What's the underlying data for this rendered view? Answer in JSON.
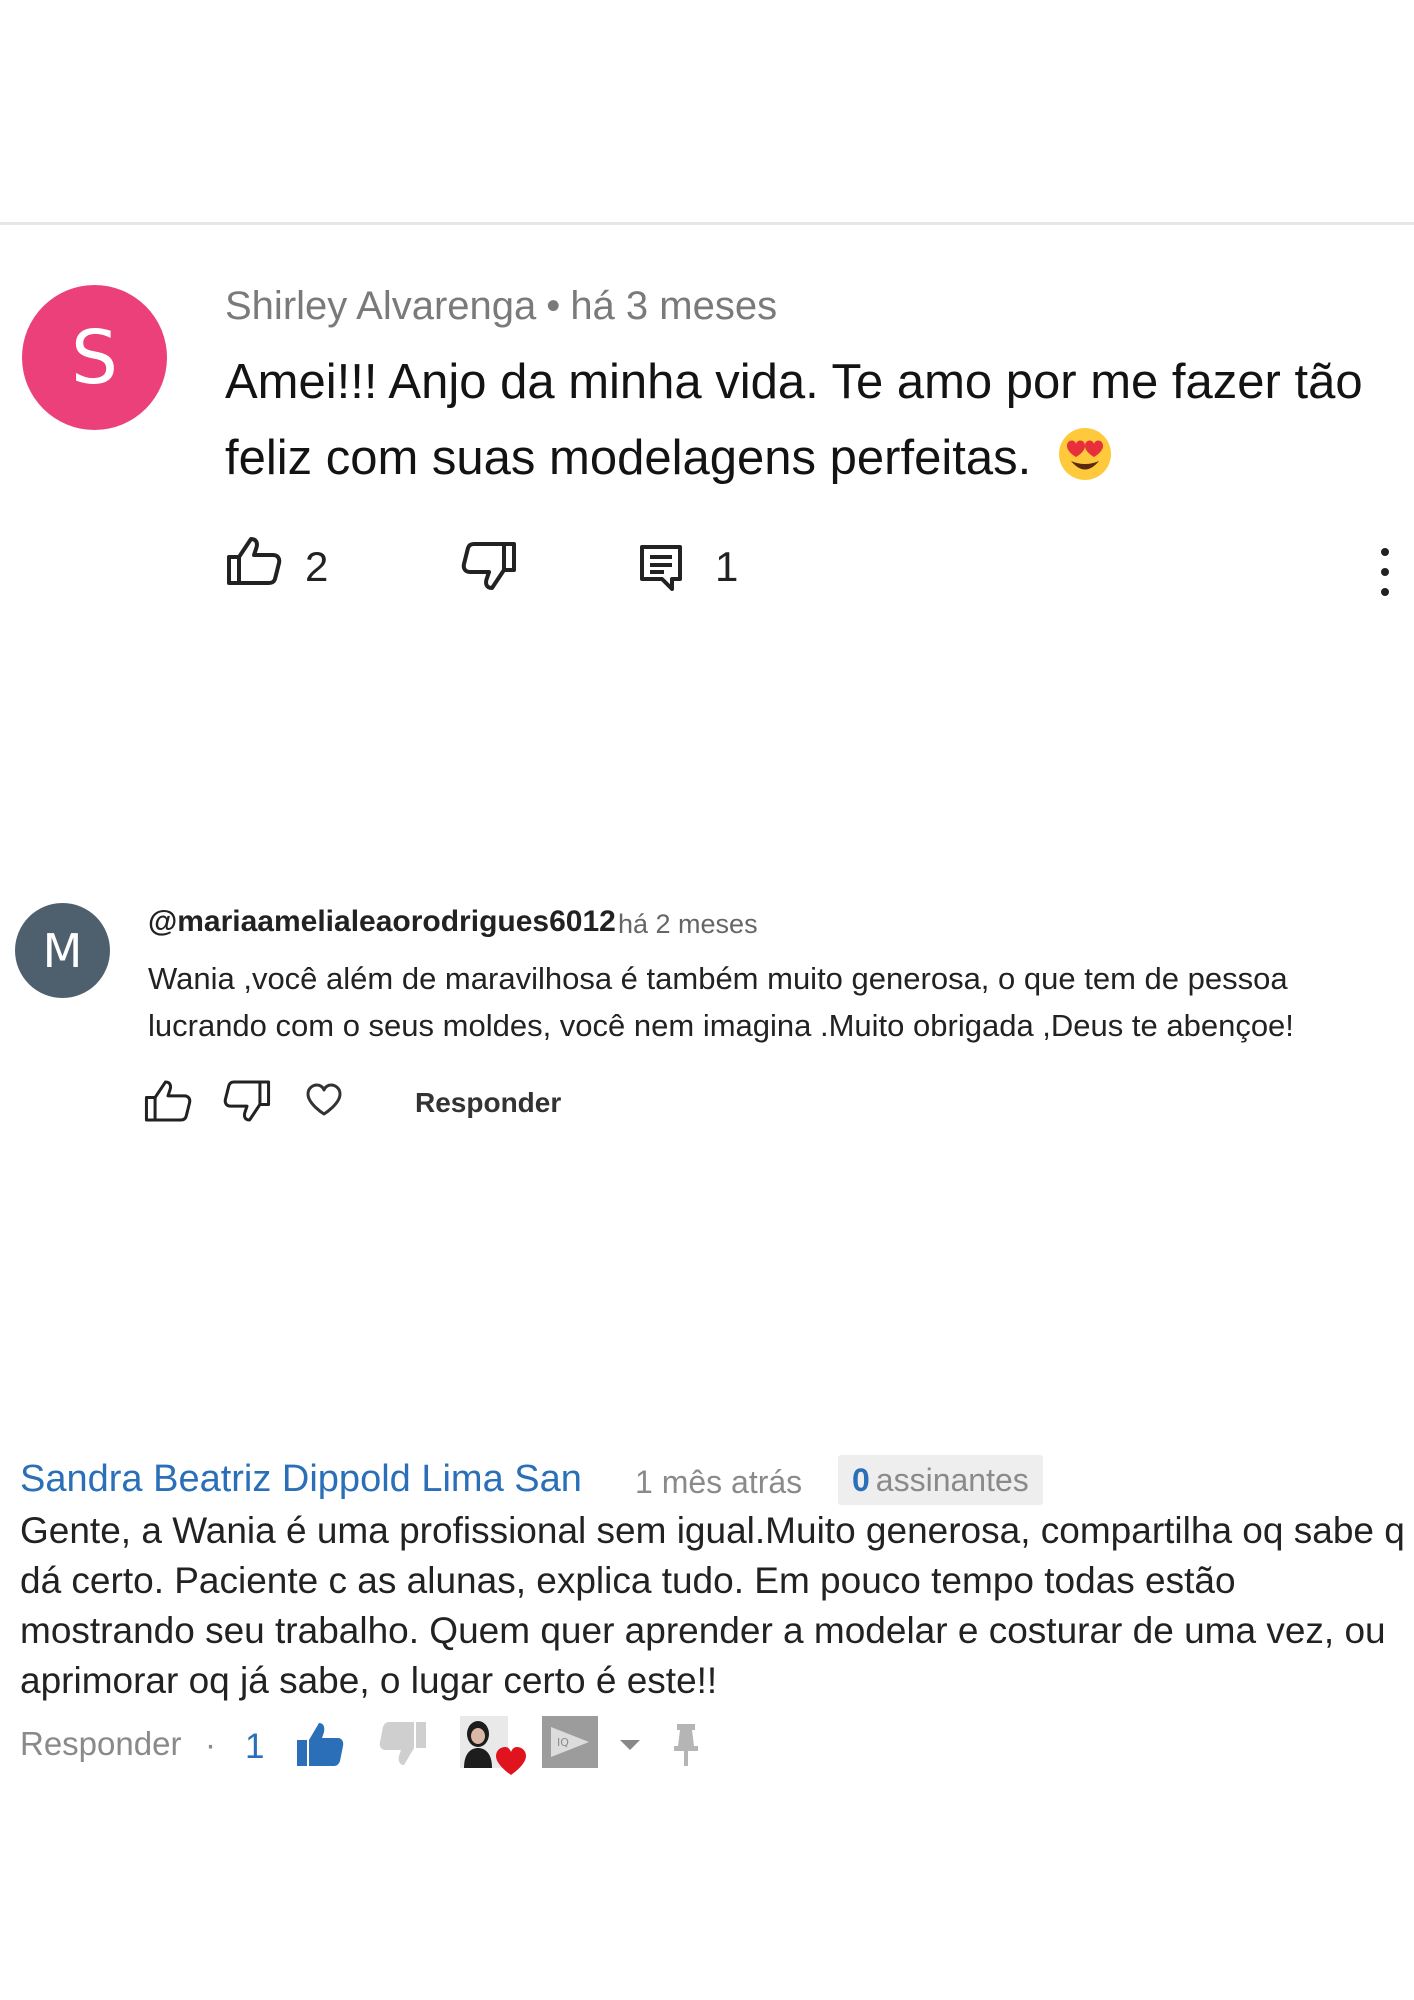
{
  "comments": {
    "first": {
      "avatar_letter": "S",
      "avatar_color": "#ec407a",
      "author": "Shirley Alvarenga",
      "separator": "•",
      "time": "há 3 meses",
      "text": "Amei!!! Anjo da minha vida. Te amo por me fazer tão feliz com suas modelagens perfeitas.",
      "emoji_icon": "heart-eyes-emoji-icon",
      "like_count": "2",
      "reply_count": "1",
      "icons": [
        "thumbs-up-icon",
        "thumbs-down-icon",
        "comment-icon",
        "more-vert-icon"
      ]
    },
    "second": {
      "avatar_letter": "M",
      "avatar_color": "#4e5f6e",
      "handle": "@mariaamelialeaorodrigues6012",
      "time": "há 2 meses",
      "text": "Wania ,você além de maravilhosa é também muito generosa, o que tem de pessoa lucrando com o seus moldes, você nem imagina .Muito obrigada ,Deus te abençoe!",
      "reply_label": "Responder",
      "icons": [
        "thumbs-up-icon",
        "thumbs-down-icon",
        "heart-icon"
      ]
    },
    "third": {
      "author": "Sandra Beatriz Dippold Lima San",
      "time": "1 mês atrás",
      "subscribers_count": "0",
      "subscribers_label": "assinantes",
      "text": "Gente, a Wania é uma profissional sem igual.Muito generosa, compartilha oq sabe q dá certo. Paciente c as alunas, explica tudo. Em pouco tempo todas estão mostrando seu trabalho. Quem quer aprender a modelar e costurar de uma vez, ou aprimorar oq já sabe, o lugar certo é este!!",
      "reply_label": "Responder",
      "separator": "·",
      "like_count": "1",
      "link_color": "#2a6fb7",
      "icons": [
        "thumbs-up-filled-icon",
        "thumbs-down-filled-icon",
        "creator-heart-icon",
        "promote-icon",
        "caret-down-icon",
        "pin-icon"
      ]
    }
  }
}
